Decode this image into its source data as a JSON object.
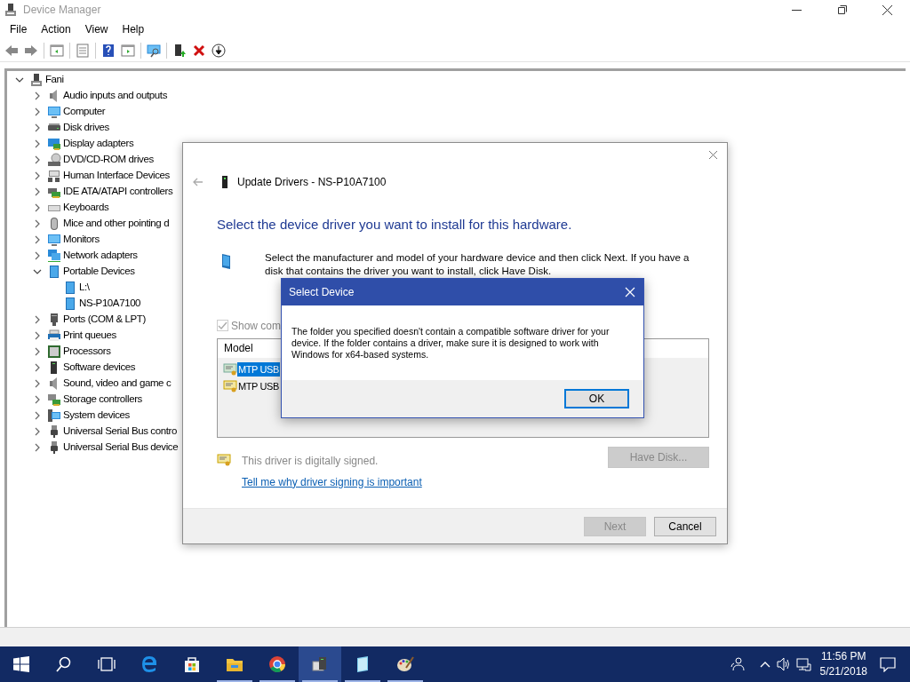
{
  "window": {
    "title": "Device Manager"
  },
  "menu": [
    "File",
    "Action",
    "View",
    "Help"
  ],
  "tree": {
    "label": "Fani",
    "expanded": true,
    "children": [
      {
        "label": "Audio inputs and outputs",
        "expanded": false
      },
      {
        "label": "Computer",
        "expanded": false
      },
      {
        "label": "Disk drives",
        "expanded": false
      },
      {
        "label": "Display adapters",
        "expanded": false
      },
      {
        "label": "DVD/CD-ROM drives",
        "expanded": false
      },
      {
        "label": "Human Interface Devices",
        "expanded": false
      },
      {
        "label": "IDE ATA/ATAPI controllers",
        "expanded": false
      },
      {
        "label": "Keyboards",
        "expanded": false
      },
      {
        "label": "Mice and other pointing d",
        "expanded": false
      },
      {
        "label": "Monitors",
        "expanded": false
      },
      {
        "label": "Network adapters",
        "expanded": false
      },
      {
        "label": "Portable Devices",
        "expanded": true,
        "children": [
          {
            "label": "L:\\"
          },
          {
            "label": "NS-P10A7100"
          }
        ]
      },
      {
        "label": "Ports (COM & LPT)",
        "expanded": false
      },
      {
        "label": "Print queues",
        "expanded": false
      },
      {
        "label": "Processors",
        "expanded": false
      },
      {
        "label": "Software devices",
        "expanded": false
      },
      {
        "label": "Sound, video and game c",
        "expanded": false
      },
      {
        "label": "Storage controllers",
        "expanded": false
      },
      {
        "label": "System devices",
        "expanded": false
      },
      {
        "label": "Universal Serial Bus contro",
        "expanded": false
      },
      {
        "label": "Universal Serial Bus device",
        "expanded": false
      }
    ]
  },
  "update_dialog": {
    "title": "Update Drivers - NS-P10A7100",
    "heading": "Select the device driver you want to install for this hardware.",
    "description": "Select the manufacturer and model of your hardware device and then click Next. If you have a disk that contains the driver you want to install, click Have Disk.",
    "show_compatible": {
      "label": "Show com",
      "checked": true,
      "disabled": true
    },
    "model_list": {
      "column": "Model",
      "rows": [
        {
          "label": "MTP USB",
          "selected": true
        },
        {
          "label": "MTP USB",
          "selected": false
        }
      ]
    },
    "signed_text": "This driver is digitally signed.",
    "link": "Tell me why driver signing is important",
    "have_disk": {
      "label": "Have Disk...",
      "disabled": true
    },
    "buttons": [
      {
        "label": "Next",
        "disabled": true
      },
      {
        "label": "Cancel",
        "disabled": false
      }
    ]
  },
  "select_device": {
    "title": "Select Device",
    "message": "The folder you specified doesn't contain a compatible software driver for your device. If the folder contains a driver, make sure it is designed to work with Windows for x64-based systems.",
    "button": "OK"
  },
  "taskbar": {
    "apps": [
      {
        "running": false,
        "active": false
      },
      {
        "running": false,
        "active": false
      },
      {
        "running": true,
        "active": false
      },
      {
        "running": true,
        "active": false
      },
      {
        "running": true,
        "active": true
      },
      {
        "running": true,
        "active": false
      },
      {
        "running": true,
        "active": false
      }
    ],
    "time": "11:56 PM",
    "date": "5/21/2018"
  }
}
